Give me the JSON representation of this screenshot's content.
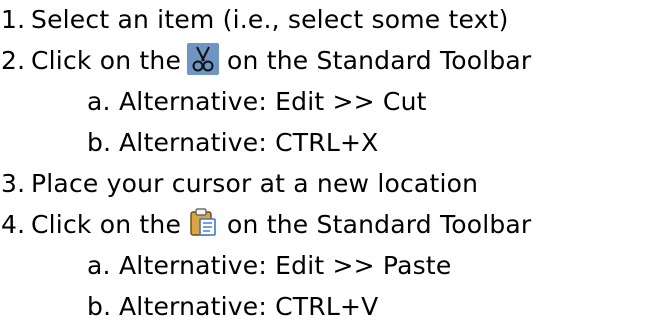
{
  "steps": [
    {
      "num": "1.",
      "text": "Select an item (i.e., select some text)"
    },
    {
      "num": "2.",
      "pre": "Click on the",
      "icon": "scissors-cut-icon",
      "post": "on the Standard Toolbar"
    },
    {
      "letter": "a.",
      "text": "Alternative: Edit >> Cut"
    },
    {
      "letter": "b.",
      "text": "Alternative: CTRL+X"
    },
    {
      "num": "3.",
      "text": "Place your cursor at a new location"
    },
    {
      "num": "4.",
      "pre": "Click on the",
      "icon": "clipboard-paste-icon",
      "post": "on the Standard Toolbar"
    },
    {
      "letter": "a.",
      "text": "Alternative: Edit >> Paste"
    },
    {
      "letter": "b.",
      "text": "Alternative: CTRL+V"
    }
  ],
  "colors": {
    "text": "#000000",
    "cut_icon_bg": "#6f95c4",
    "paste_icon_gold": "#d9a441",
    "paste_icon_blue": "#3d78c8"
  }
}
